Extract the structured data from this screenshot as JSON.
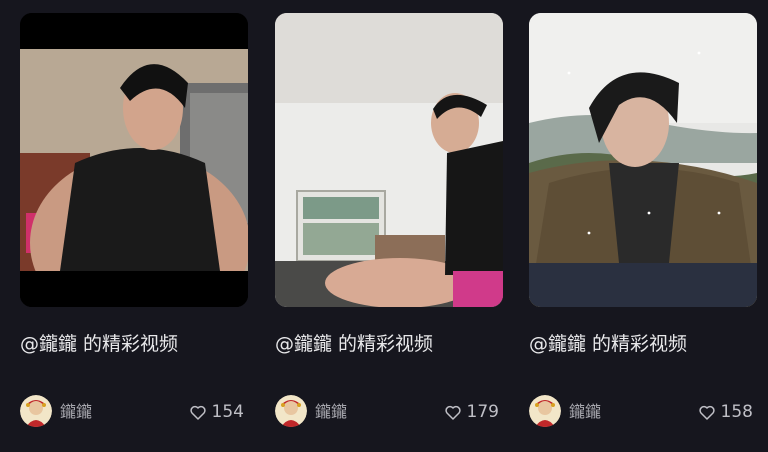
{
  "videos": [
    {
      "title": "@鑨鑨 的精彩视频",
      "author": "鑨鑨",
      "likes": "154",
      "thumbnail": "gym-selfie-black-tank",
      "accent": "#b98e78"
    },
    {
      "title": "@鑨鑨 的精彩视频",
      "author": "鑨鑨",
      "likes": "179",
      "thumbnail": "kitchen-cooking-black-tank",
      "accent": "#d6d6d2"
    },
    {
      "title": "@鑨鑨 的精彩视频",
      "author": "鑨鑨",
      "likes": "158",
      "thumbnail": "outdoor-brown-jacket-snow",
      "accent": "#6e5a40"
    }
  ],
  "icons": {
    "like": "heart-outline-icon",
    "avatar": "user-avatar"
  }
}
